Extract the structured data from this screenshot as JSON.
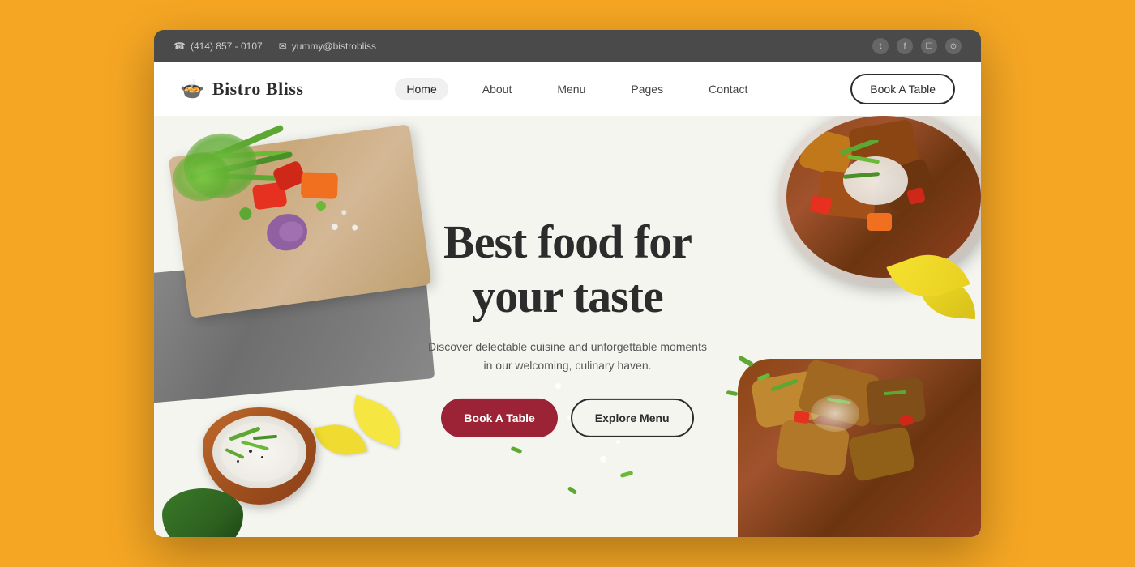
{
  "topbar": {
    "phone": "(414) 857 - 0107",
    "email": "yummy@bistrobliss",
    "phone_icon": "☎",
    "email_icon": "✉",
    "social": [
      {
        "name": "twitter",
        "label": "t"
      },
      {
        "name": "facebook",
        "label": "f"
      },
      {
        "name": "instagram",
        "label": "◻"
      },
      {
        "name": "github",
        "label": "◯"
      }
    ]
  },
  "header": {
    "logo_icon": "🍲",
    "logo_text": "Bistro Bliss",
    "nav_items": [
      {
        "label": "Home",
        "active": true
      },
      {
        "label": "About",
        "active": false
      },
      {
        "label": "Menu",
        "active": false
      },
      {
        "label": "Pages",
        "active": false
      },
      {
        "label": "Contact",
        "active": false
      }
    ],
    "book_btn": "Book A Table"
  },
  "hero": {
    "title_line1": "Best food for",
    "title_line2": "your taste",
    "subtitle": "Discover delectable cuisine and unforgettable moments\nin our welcoming, culinary haven.",
    "btn_primary": "Book A Table",
    "btn_secondary": "Explore Menu"
  }
}
